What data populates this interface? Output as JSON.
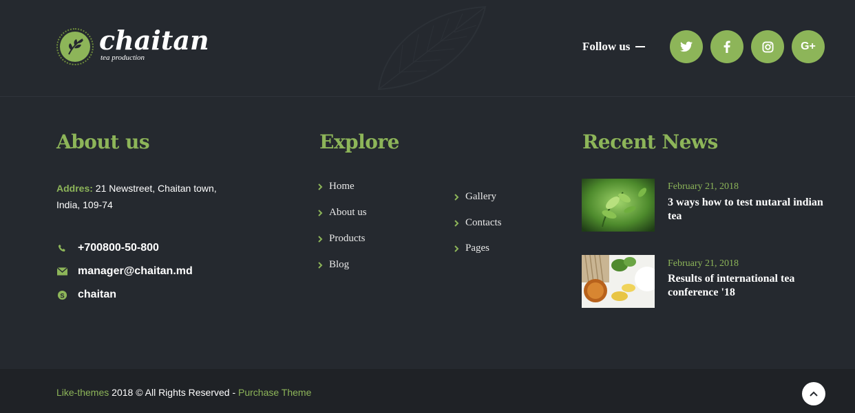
{
  "brand": {
    "name": "chaitan",
    "tagline": "tea production"
  },
  "follow": {
    "label": "Follow us",
    "socials": [
      {
        "icon": "twitter-icon",
        "glyph": "t"
      },
      {
        "icon": "facebook-icon",
        "glyph": "f"
      },
      {
        "icon": "instagram-icon",
        "glyph": ""
      },
      {
        "icon": "google-plus-icon",
        "glyph": "G+"
      }
    ]
  },
  "about": {
    "title": "About us",
    "address_label": "Addres:",
    "address_value": "21 Newstreet, Chaitan town, India, 109-74",
    "phone": "+700800-50-800",
    "email": "manager@chaitan.md",
    "skype": "chaitan"
  },
  "explore": {
    "title": "Explore",
    "col1": [
      "Home",
      "About us",
      "Products",
      "Blog"
    ],
    "col2": [
      "Gallery",
      "Contacts",
      "Pages"
    ]
  },
  "news": {
    "title": "Recent News",
    "items": [
      {
        "date": "February 21, 2018",
        "title": "3 ways how to test nutaral indian tea"
      },
      {
        "date": "February 21, 2018",
        "title": "Results of international tea conference '18"
      }
    ]
  },
  "footer": {
    "link1": "Like-themes",
    "middle": " 2018 © All Rights Reserved - ",
    "link2": "Purchase Theme"
  },
  "colors": {
    "accent": "#8db559",
    "background": "#25292f",
    "bottom_bar": "#1f2226"
  }
}
